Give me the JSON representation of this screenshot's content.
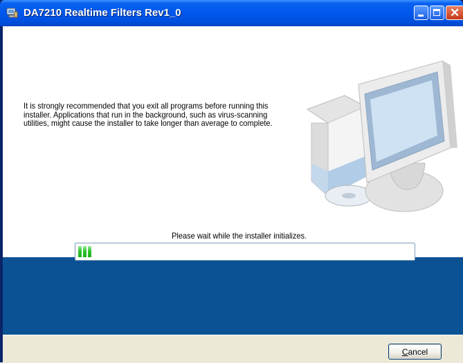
{
  "window": {
    "title": "DA7210 Realtime Filters Rev1_0",
    "icon": "installer-app-icon",
    "controls": [
      "minimize-icon",
      "maximize-icon",
      "close-icon"
    ]
  },
  "main": {
    "advice_text": "It is strongly recommended that you exit all programs before running this installer. Applications that run in the background, such as virus-scanning utilities, might cause the installer to take longer than average to complete.",
    "illustration": "computer-with-box-and-cd",
    "status_text": "Please wait while the installer initializes.",
    "progress_fraction": 0.04
  },
  "footer": {
    "cancel_label_accel": "C",
    "cancel_label_rest": "ancel"
  },
  "colors": {
    "titlebar": "#0058ee",
    "band": "#0a5293",
    "progress": "#2cc42c",
    "dialog_bg": "#ece9d8"
  }
}
